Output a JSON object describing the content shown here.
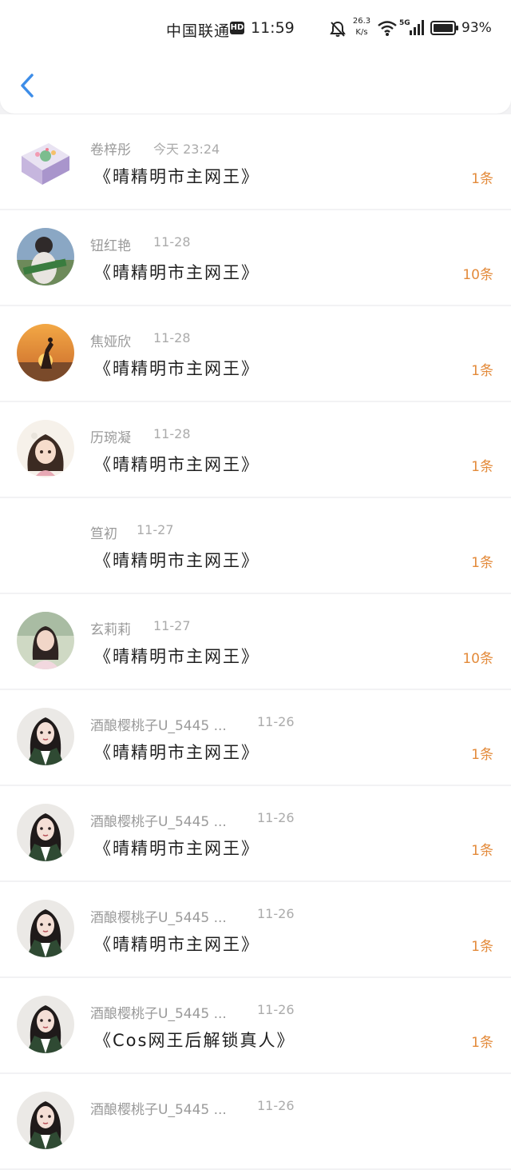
{
  "status_bar": {
    "carrier": "中国联通",
    "hd": "HD",
    "time": "11:59",
    "net_speed": "26.3",
    "net_unit": "K/s",
    "battery": "93%",
    "icons": [
      "mute-icon",
      "wifi-icon",
      "signal-5g-icon",
      "battery-icon"
    ]
  },
  "header": {
    "back_icon": "chevron-left-icon"
  },
  "colors": {
    "accent_blue": "#3d8de8",
    "count_orange": "#e38a3a",
    "name_gray": "#9a9a9a"
  },
  "messages": [
    {
      "name": "卷梓彤",
      "time": "今天 23:24",
      "text": "《晴精明市主网王》",
      "count": "1条",
      "avatar": "gift-box-avatar"
    },
    {
      "name": "钮红艳",
      "time": "11-28",
      "text": "《晴精明市主网王》",
      "count": "10条",
      "avatar": "portrait-avatar"
    },
    {
      "name": "焦娅欣",
      "time": "11-28",
      "text": "《晴精明市主网王》",
      "count": "1条",
      "avatar": "sunset-avatar"
    },
    {
      "name": "历琬凝",
      "time": "11-28",
      "text": "《晴精明市主网王》",
      "count": "1条",
      "avatar": "anime-girl-avatar"
    },
    {
      "name": "笪初",
      "time": "11-27",
      "text": "《晴精明市主网王》",
      "count": "1条",
      "avatar": "empty-avatar"
    },
    {
      "name": "玄莉莉",
      "time": "11-27",
      "text": "《晴精明市主网王》",
      "count": "10条",
      "avatar": "girl-photo-avatar"
    },
    {
      "name": "酒酿樱桃子U_5445 ...",
      "time": "11-26",
      "text": "《晴精明市主网王》",
      "count": "1条",
      "avatar": "illustrated-woman-avatar"
    },
    {
      "name": "酒酿樱桃子U_5445 ...",
      "time": "11-26",
      "text": "《晴精明市主网王》",
      "count": "1条",
      "avatar": "illustrated-woman-avatar"
    },
    {
      "name": "酒酿樱桃子U_5445 ...",
      "time": "11-26",
      "text": "《晴精明市主网王》",
      "count": "1条",
      "avatar": "illustrated-woman-avatar"
    },
    {
      "name": "酒酿樱桃子U_5445 ...",
      "time": "11-26",
      "text": "《Cos网王后解锁真人》",
      "count": "1条",
      "avatar": "illustrated-woman-avatar"
    },
    {
      "name": "酒酿樱桃子U_5445 ...",
      "time": "11-26",
      "text": "",
      "count": "",
      "avatar": "illustrated-woman-avatar"
    }
  ]
}
